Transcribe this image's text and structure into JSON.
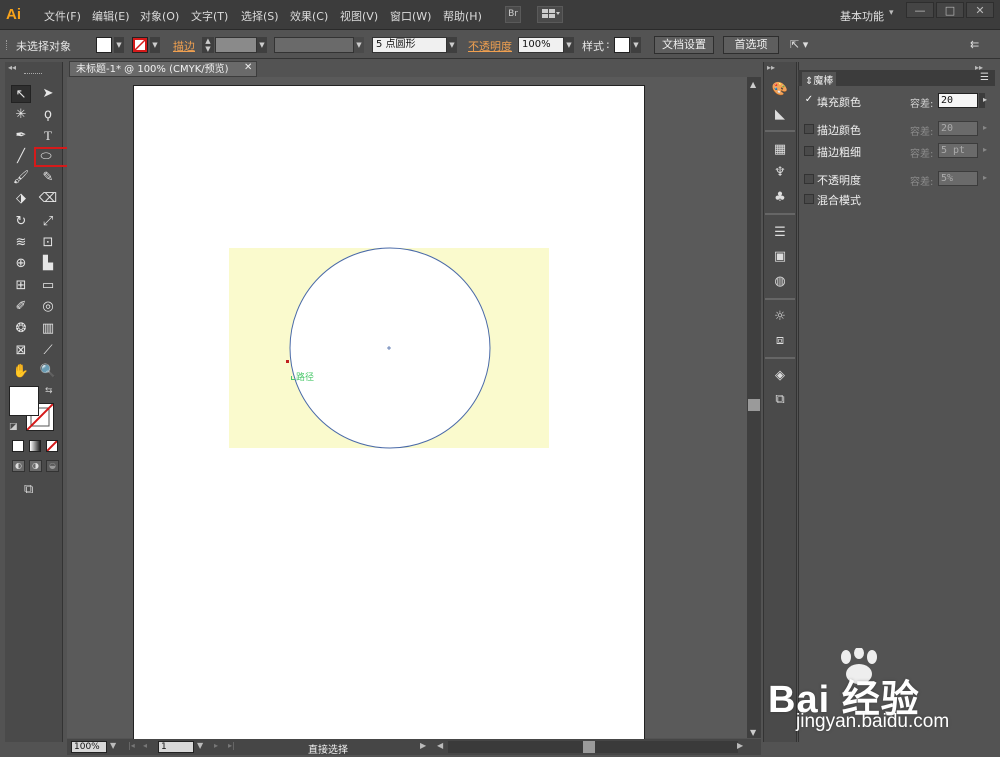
{
  "app": {
    "logo": "Ai",
    "workspace": "基本功能",
    "window_controls": [
      "—",
      "□",
      "✕"
    ]
  },
  "menu": {
    "items": [
      "文件(F)",
      "编辑(E)",
      "对象(O)",
      "文字(T)",
      "选择(S)",
      "效果(C)",
      "视图(V)",
      "窗口(W)",
      "帮助(H)"
    ],
    "bridge_label": "Br"
  },
  "control_bar": {
    "selection_status": "未选择对象",
    "stroke_label": "描边",
    "brush_label": "5 点圆形",
    "opacity_label": "不透明度",
    "opacity_value": "100%",
    "style_label": "样式",
    "doc_setup_button": "文档设置",
    "preferences_button": "首选项"
  },
  "document": {
    "tab_title": "未标题-1* @ 100% (CMYK/预览)",
    "path_hint": "路径"
  },
  "status_bar": {
    "zoom": "100%",
    "page": "1",
    "tool_status": "直接选择"
  },
  "panel": {
    "title": "魔棒",
    "rows": [
      {
        "label": "填充颜色",
        "checked": true,
        "tolerance_label": "容差:",
        "value": "20",
        "enabled": true
      },
      {
        "label": "描边颜色",
        "checked": false,
        "tolerance_label": "容差:",
        "value": "20",
        "enabled": false
      },
      {
        "label": "描边粗细",
        "checked": false,
        "tolerance_label": "容差:",
        "value": "5 pt",
        "enabled": false
      },
      {
        "label": "不透明度",
        "checked": false,
        "tolerance_label": "容差:",
        "value": "5%",
        "enabled": false
      },
      {
        "label": "混合模式",
        "checked": false
      }
    ]
  },
  "watermark": {
    "brand": "Bai 经验",
    "url": "jingyan.baidu.com"
  },
  "colors": {
    "accent_orange": "#f0a050",
    "highlight_red": "#d51a1a",
    "canvas_fill": "#fafacd"
  }
}
